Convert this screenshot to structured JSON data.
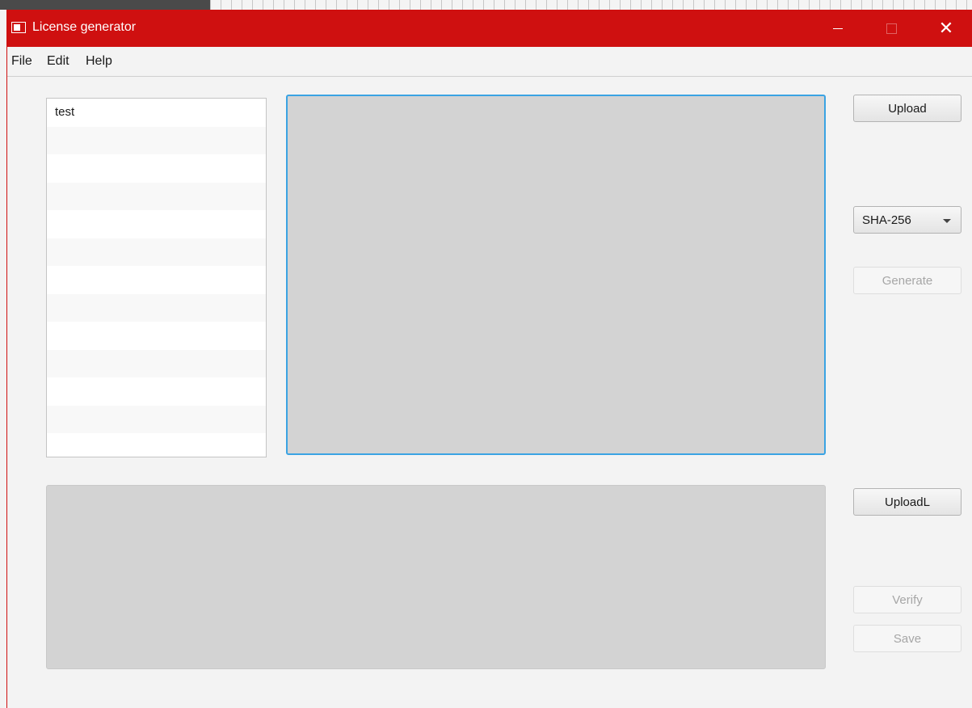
{
  "window": {
    "title": "License generator"
  },
  "menu": {
    "items": [
      "File",
      "Edit",
      "Help"
    ]
  },
  "license_list": {
    "items": [
      "test",
      "",
      "",
      "",
      "",
      "",
      "",
      "",
      "",
      "",
      "",
      "",
      ""
    ]
  },
  "buttons": {
    "upload": "Upload",
    "generate": "Generate",
    "upload_l": "UploadL",
    "verify": "Verify",
    "save": "Save"
  },
  "hash_select": {
    "selected": "SHA-256"
  },
  "colors": {
    "titlebar": "#cf1010",
    "focus_border": "#3aa3e3",
    "text_area_bg": "#d3d3d3"
  }
}
